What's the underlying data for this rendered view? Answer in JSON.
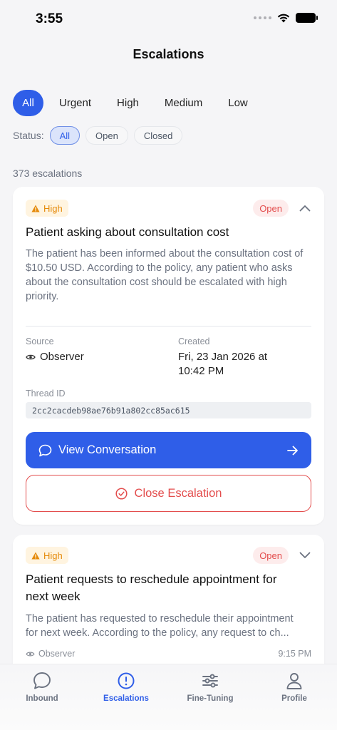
{
  "status_bar": {
    "time": "3:55"
  },
  "header": {
    "title": "Escalations"
  },
  "priority_filters": [
    {
      "label": "All",
      "active": true
    },
    {
      "label": "Urgent",
      "active": false
    },
    {
      "label": "High",
      "active": false
    },
    {
      "label": "Medium",
      "active": false
    },
    {
      "label": "Low",
      "active": false
    }
  ],
  "status_filter": {
    "label": "Status:",
    "options": [
      {
        "label": "All",
        "active": true
      },
      {
        "label": "Open",
        "active": false
      },
      {
        "label": "Closed",
        "active": false
      }
    ]
  },
  "count_text": "373 escalations",
  "cards": [
    {
      "priority": "High",
      "status": "Open",
      "title": "Patient asking about consultation cost",
      "description": "The patient has been informed about the consultation cost of $10.50 USD. According to the policy, any patient who asks about the consultation cost should be escalated with high priority.",
      "source_label": "Source",
      "source_value": "Observer",
      "created_label": "Created",
      "created_value_line1": "Fri, 23 Jan 2026 at",
      "created_value_line2": "10:42 PM",
      "thread_label": "Thread ID",
      "thread_id": "2cc2cacdeb98ae76b91a802cc85ac615",
      "view_button": "View Conversation",
      "close_button": "Close Escalation"
    },
    {
      "priority": "High",
      "status": "Open",
      "title_line1": "Patient requests to reschedule appointment for",
      "title_line2": "next week",
      "description_line1": "The patient has requested to reschedule their appointment",
      "description_line2": "for next week. According to the policy, any request to ch...",
      "source_value": "Observer",
      "time": "9:15 PM"
    }
  ],
  "tabbar": [
    {
      "label": "Inbound",
      "icon": "chat-bubble-icon",
      "active": false
    },
    {
      "label": "Escalations",
      "icon": "alert-circle-icon",
      "active": true
    },
    {
      "label": "Fine-Tuning",
      "icon": "sliders-icon",
      "active": false
    },
    {
      "label": "Profile",
      "icon": "user-icon",
      "active": false
    }
  ],
  "colors": {
    "accent": "#2f5ee8",
    "danger": "#e34d4d",
    "warning": "#e58a0a"
  }
}
